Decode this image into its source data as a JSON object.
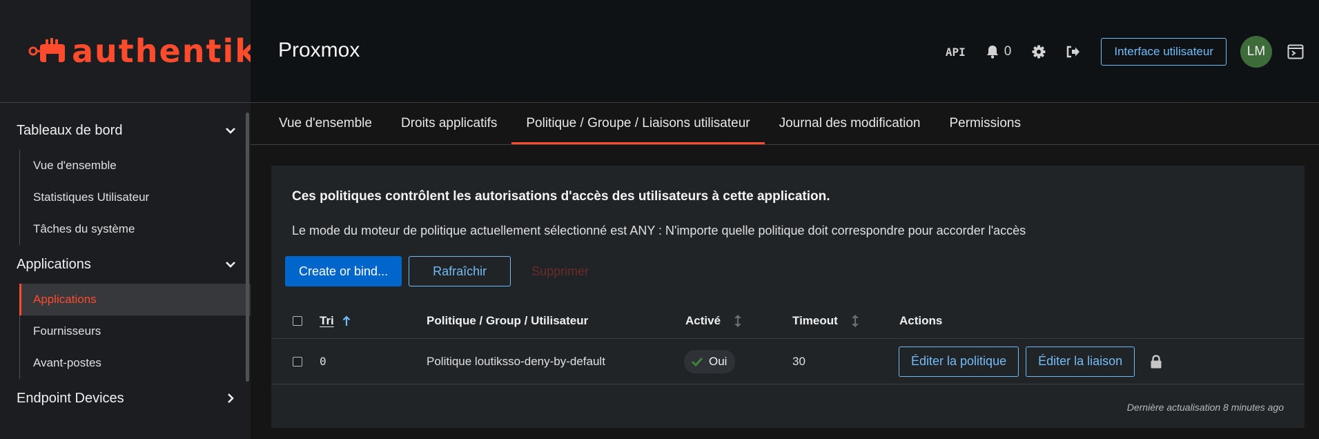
{
  "brand": {
    "name": "authentik"
  },
  "sidebar": {
    "groups": [
      {
        "label": "Tableaux de bord",
        "expanded": true,
        "items": [
          "Vue d'ensemble",
          "Statistiques Utilisateur",
          "Tâches du système"
        ]
      },
      {
        "label": "Applications",
        "expanded": true,
        "items": [
          "Applications",
          "Fournisseurs",
          "Avant-postes"
        ],
        "active_item": "Applications"
      },
      {
        "label": "Endpoint Devices",
        "expanded": false
      }
    ]
  },
  "header": {
    "title": "Proxmox",
    "api_label": "API",
    "notification_count": "0",
    "user_interface_button": "Interface utilisateur",
    "avatar_initials": "LM"
  },
  "tabs": [
    {
      "label": "Vue d'ensemble",
      "active": false
    },
    {
      "label": "Droits applicatifs",
      "active": false
    },
    {
      "label": "Politique / Groupe / Liaisons utilisateur",
      "active": true
    },
    {
      "label": "Journal des modification",
      "active": false
    },
    {
      "label": "Permissions",
      "active": false
    }
  ],
  "card": {
    "title": "Ces politiques contrôlent les autorisations d'accès des utilisateurs à cette application.",
    "description": "Le mode du moteur de politique actuellement sélectionné est ANY : N'importe quelle politique doit correspondre pour accorder l'accès",
    "buttons": {
      "create": "Create or bind...",
      "refresh": "Rafraîchir",
      "delete": "Supprimer"
    },
    "table": {
      "columns": {
        "order": "Tri",
        "target": "Politique / Group / Utilisateur",
        "enabled": "Activé",
        "timeout": "Timeout",
        "actions": "Actions"
      },
      "rows": [
        {
          "order": "0",
          "target": "Politique loutiksso-deny-by-default",
          "enabled": "Oui",
          "timeout": "30",
          "actions": {
            "edit_policy": "Éditer la politique",
            "edit_binding": "Éditer la liaison"
          }
        }
      ]
    },
    "last_refresh": "Dernière actualisation 8 minutes ago"
  },
  "colors": {
    "brand": "#fd4b2d",
    "link": "#73bcf7",
    "primary": "#0066cc",
    "success": "#3e8635"
  }
}
